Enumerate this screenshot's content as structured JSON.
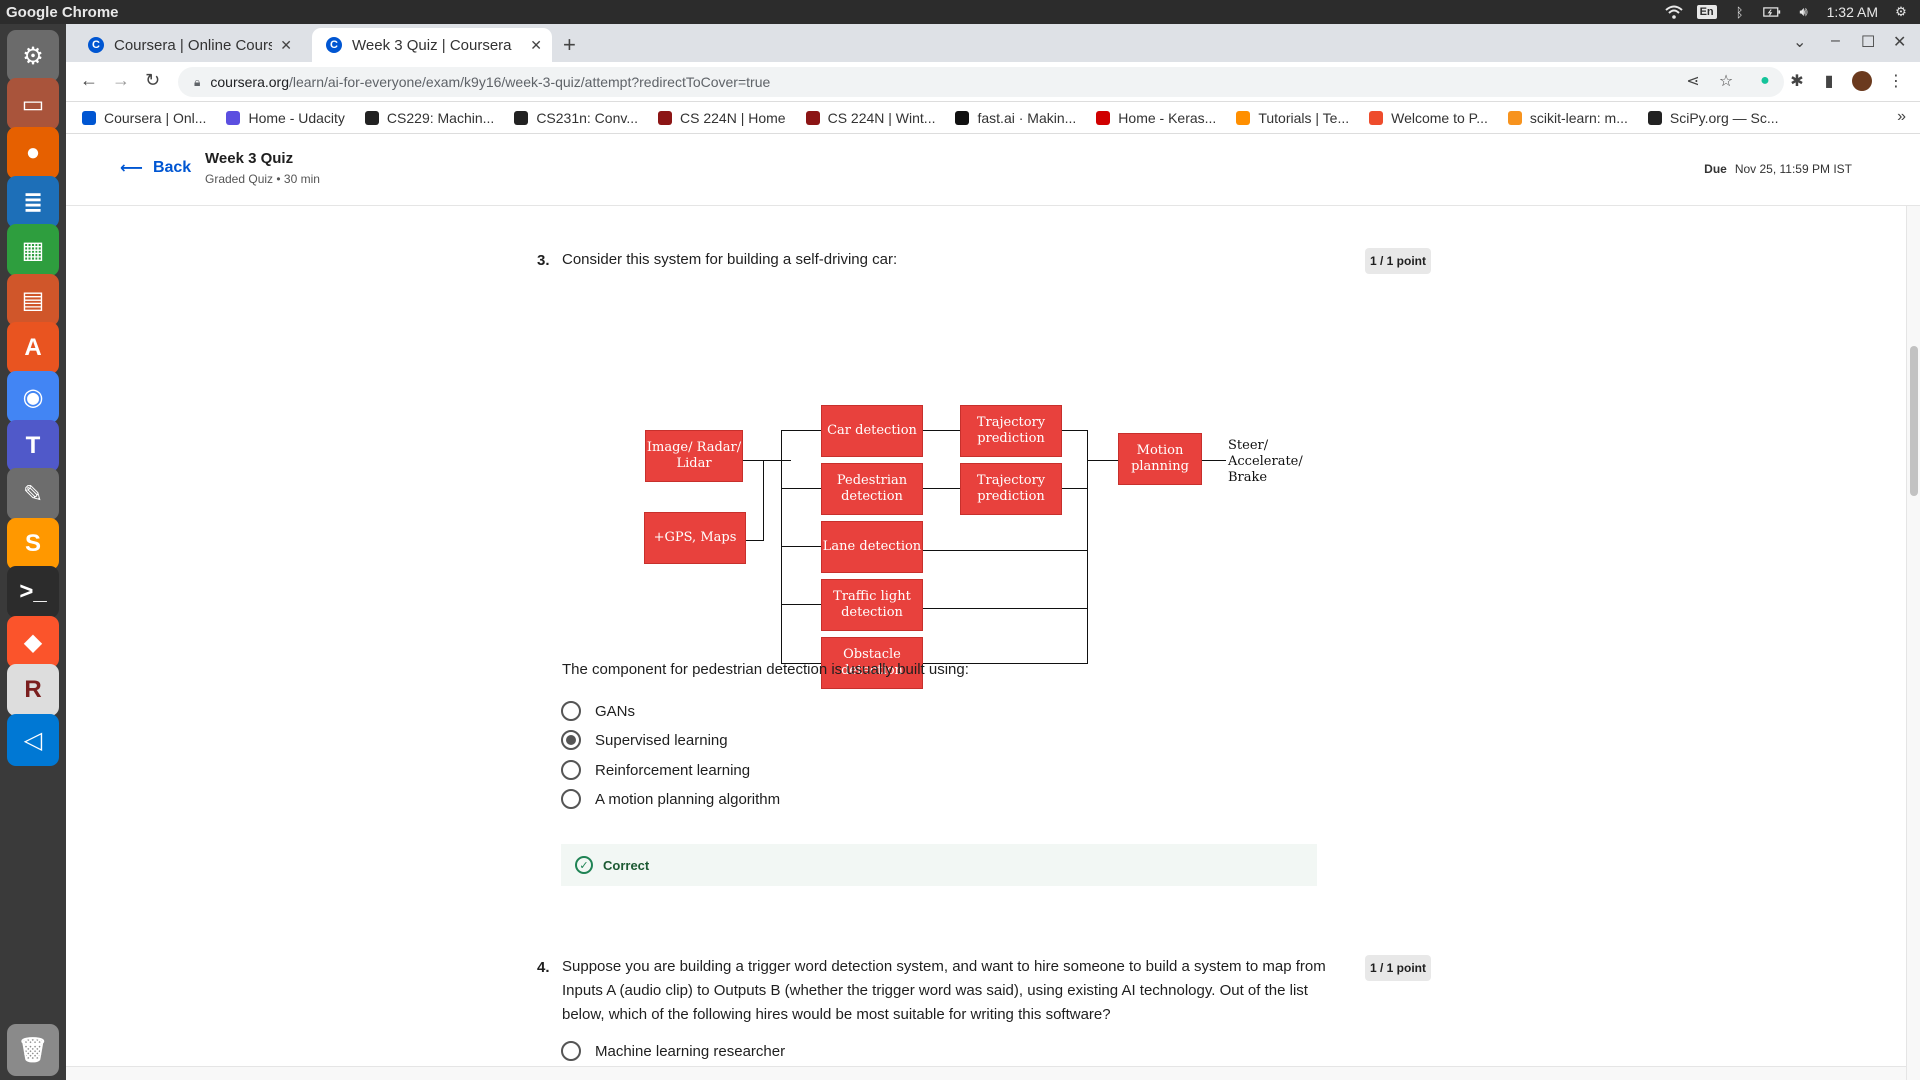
{
  "os": {
    "app_name": "Google Chrome",
    "lang": "En",
    "time": "1:32 AM"
  },
  "dock": [
    {
      "name": "settings-icon",
      "color": "#6b6b6b"
    },
    {
      "name": "files-icon",
      "color": "#a9543b"
    },
    {
      "name": "firefox-icon",
      "color": "#e66000"
    },
    {
      "name": "writer-icon",
      "color": "#1d6fb8"
    },
    {
      "name": "calc-icon",
      "color": "#2e9e3e"
    },
    {
      "name": "impress-icon",
      "color": "#d0562a"
    },
    {
      "name": "software-center-icon",
      "color": "#e95420"
    },
    {
      "name": "chrome-icon",
      "color": "#4285f4"
    },
    {
      "name": "teams-icon",
      "color": "#5059c9"
    },
    {
      "name": "text-editor-icon",
      "color": "#6d6d6d"
    },
    {
      "name": "sublime-icon",
      "color": "#ff9800"
    },
    {
      "name": "terminal-icon",
      "color": "#2c2c2c"
    },
    {
      "name": "brave-icon",
      "color": "#fb542b"
    },
    {
      "name": "rstudio-icon",
      "color": "#dddddd"
    },
    {
      "name": "vscode-icon",
      "color": "#0078d4"
    },
    {
      "name": "trash-icon",
      "color": "#8a8a8a"
    }
  ],
  "tabs": [
    {
      "title": "Coursera | Online Courses",
      "active": false
    },
    {
      "title": "Week 3 Quiz | Coursera",
      "active": true
    }
  ],
  "url": {
    "host": "coursera.org",
    "path": "/learn/ai-for-everyone/exam/k9y16/week-3-quiz/attempt?redirectToCover=true"
  },
  "bookmarks": [
    {
      "label": "Coursera | Onl...",
      "color": "#0056d2"
    },
    {
      "label": "Home - Udacity",
      "color": "#5b4fe0"
    },
    {
      "label": "CS229: Machin...",
      "color": "#222222"
    },
    {
      "label": "CS231n: Conv...",
      "color": "#222222"
    },
    {
      "label": "CS 224N | Home",
      "color": "#8c1515"
    },
    {
      "label": "CS 224N | Wint...",
      "color": "#8c1515"
    },
    {
      "label": "fast.ai · Makin...",
      "color": "#111111"
    },
    {
      "label": "Home - Keras...",
      "color": "#d00000"
    },
    {
      "label": "Tutorials  |  Te...",
      "color": "#ff8f00"
    },
    {
      "label": "Welcome to P...",
      "color": "#ee4c2c"
    },
    {
      "label": "scikit-learn: m...",
      "color": "#f7931e"
    },
    {
      "label": "SciPy.org — Sc...",
      "color": "#222222"
    }
  ],
  "header": {
    "back": "Back",
    "title": "Week 3 Quiz",
    "subtitle": "Graded Quiz • 30 min",
    "due_label": "Due",
    "due_value": "Nov 25, 11:59 PM IST"
  },
  "q3": {
    "number": "3.",
    "text": "Consider this system for building a self-driving car:",
    "points": "1 / 1 point",
    "prompt": "The component for pedestrian detection is usually built using:",
    "options": [
      "GANs",
      "Supervised learning",
      "Reinforcement learning",
      "A motion planning algorithm"
    ],
    "selected_index": 1,
    "feedback": "Correct"
  },
  "diagram": {
    "inputs": [
      "Image/ Radar/ Lidar",
      "+GPS, Maps"
    ],
    "detectors": [
      "Car detection",
      "Pedestrian detection",
      "Lane detection",
      "Traffic light detection",
      "Obstacle detection"
    ],
    "predictions": [
      "Trajectory prediction",
      "Trajectory prediction"
    ],
    "planning": "Motion planning",
    "output": "Steer/ Accelerate/ Brake"
  },
  "q4": {
    "number": "4.",
    "text": "Suppose you are building a trigger word detection system, and want to hire someone to build a system to map from Inputs A (audio clip) to Outputs B (whether the trigger word was said), using existing AI technology. Out of the list below, which of the following hires would be most suitable for writing this software?",
    "points": "1 / 1 point",
    "options": [
      "Machine learning researcher"
    ]
  }
}
